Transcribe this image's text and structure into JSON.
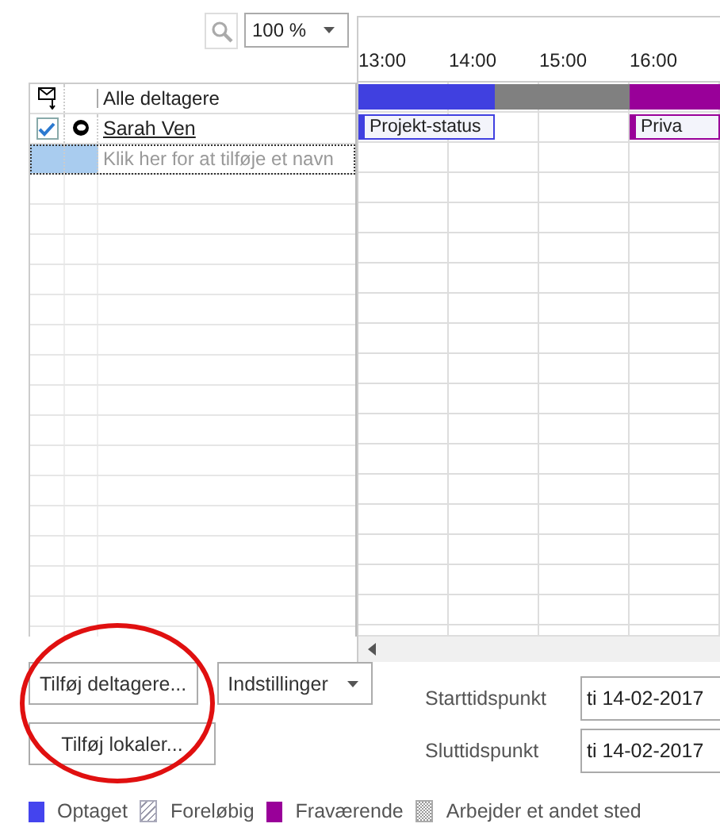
{
  "toolbar": {
    "zoom": "100 %"
  },
  "attendees": {
    "header": "Alle deltagere",
    "rows": [
      {
        "name": "Sarah Ven",
        "checked": true,
        "kind": "organizer"
      }
    ],
    "add_placeholder": "Klik her for at tilføje et navn"
  },
  "timeline": {
    "hours": [
      "13:00",
      "14:00",
      "15:00",
      "16:00"
    ],
    "all_busy": [
      {
        "kind": "busy"
      },
      {
        "kind": "busy"
      },
      {
        "kind": "busy"
      },
      {
        "kind": "merged"
      },
      {
        "kind": "merged"
      },
      {
        "kind": "merged"
      },
      {
        "kind": "away"
      },
      {
        "kind": "away"
      }
    ],
    "rows": [
      {
        "slots": [
          {
            "kind": "busy",
            "label": "Projekt-status"
          },
          {
            "kind": "busy"
          },
          {
            "kind": "busy"
          },
          {
            "kind": "free"
          },
          {
            "kind": "free"
          },
          {
            "kind": "free"
          },
          {
            "kind": "away",
            "label": "Priva"
          },
          {
            "kind": "away"
          }
        ]
      }
    ]
  },
  "buttons": {
    "add_attendees": "Tilføj deltagere...",
    "options": "Indstillinger",
    "add_rooms": "Tilføj lokaler..."
  },
  "times": [
    {
      "label": "Starttidspunkt",
      "date": "ti 14-02-2017"
    },
    {
      "label": "Sluttidspunkt",
      "date": "ti 14-02-2017"
    }
  ],
  "legend": [
    {
      "label": "Optaget",
      "kind": "busy"
    },
    {
      "label": "Foreløbig",
      "kind": "tentative"
    },
    {
      "label": "Fraværende",
      "kind": "away"
    },
    {
      "label": "Arbejder et andet sted",
      "kind": "elsewhere"
    }
  ]
}
